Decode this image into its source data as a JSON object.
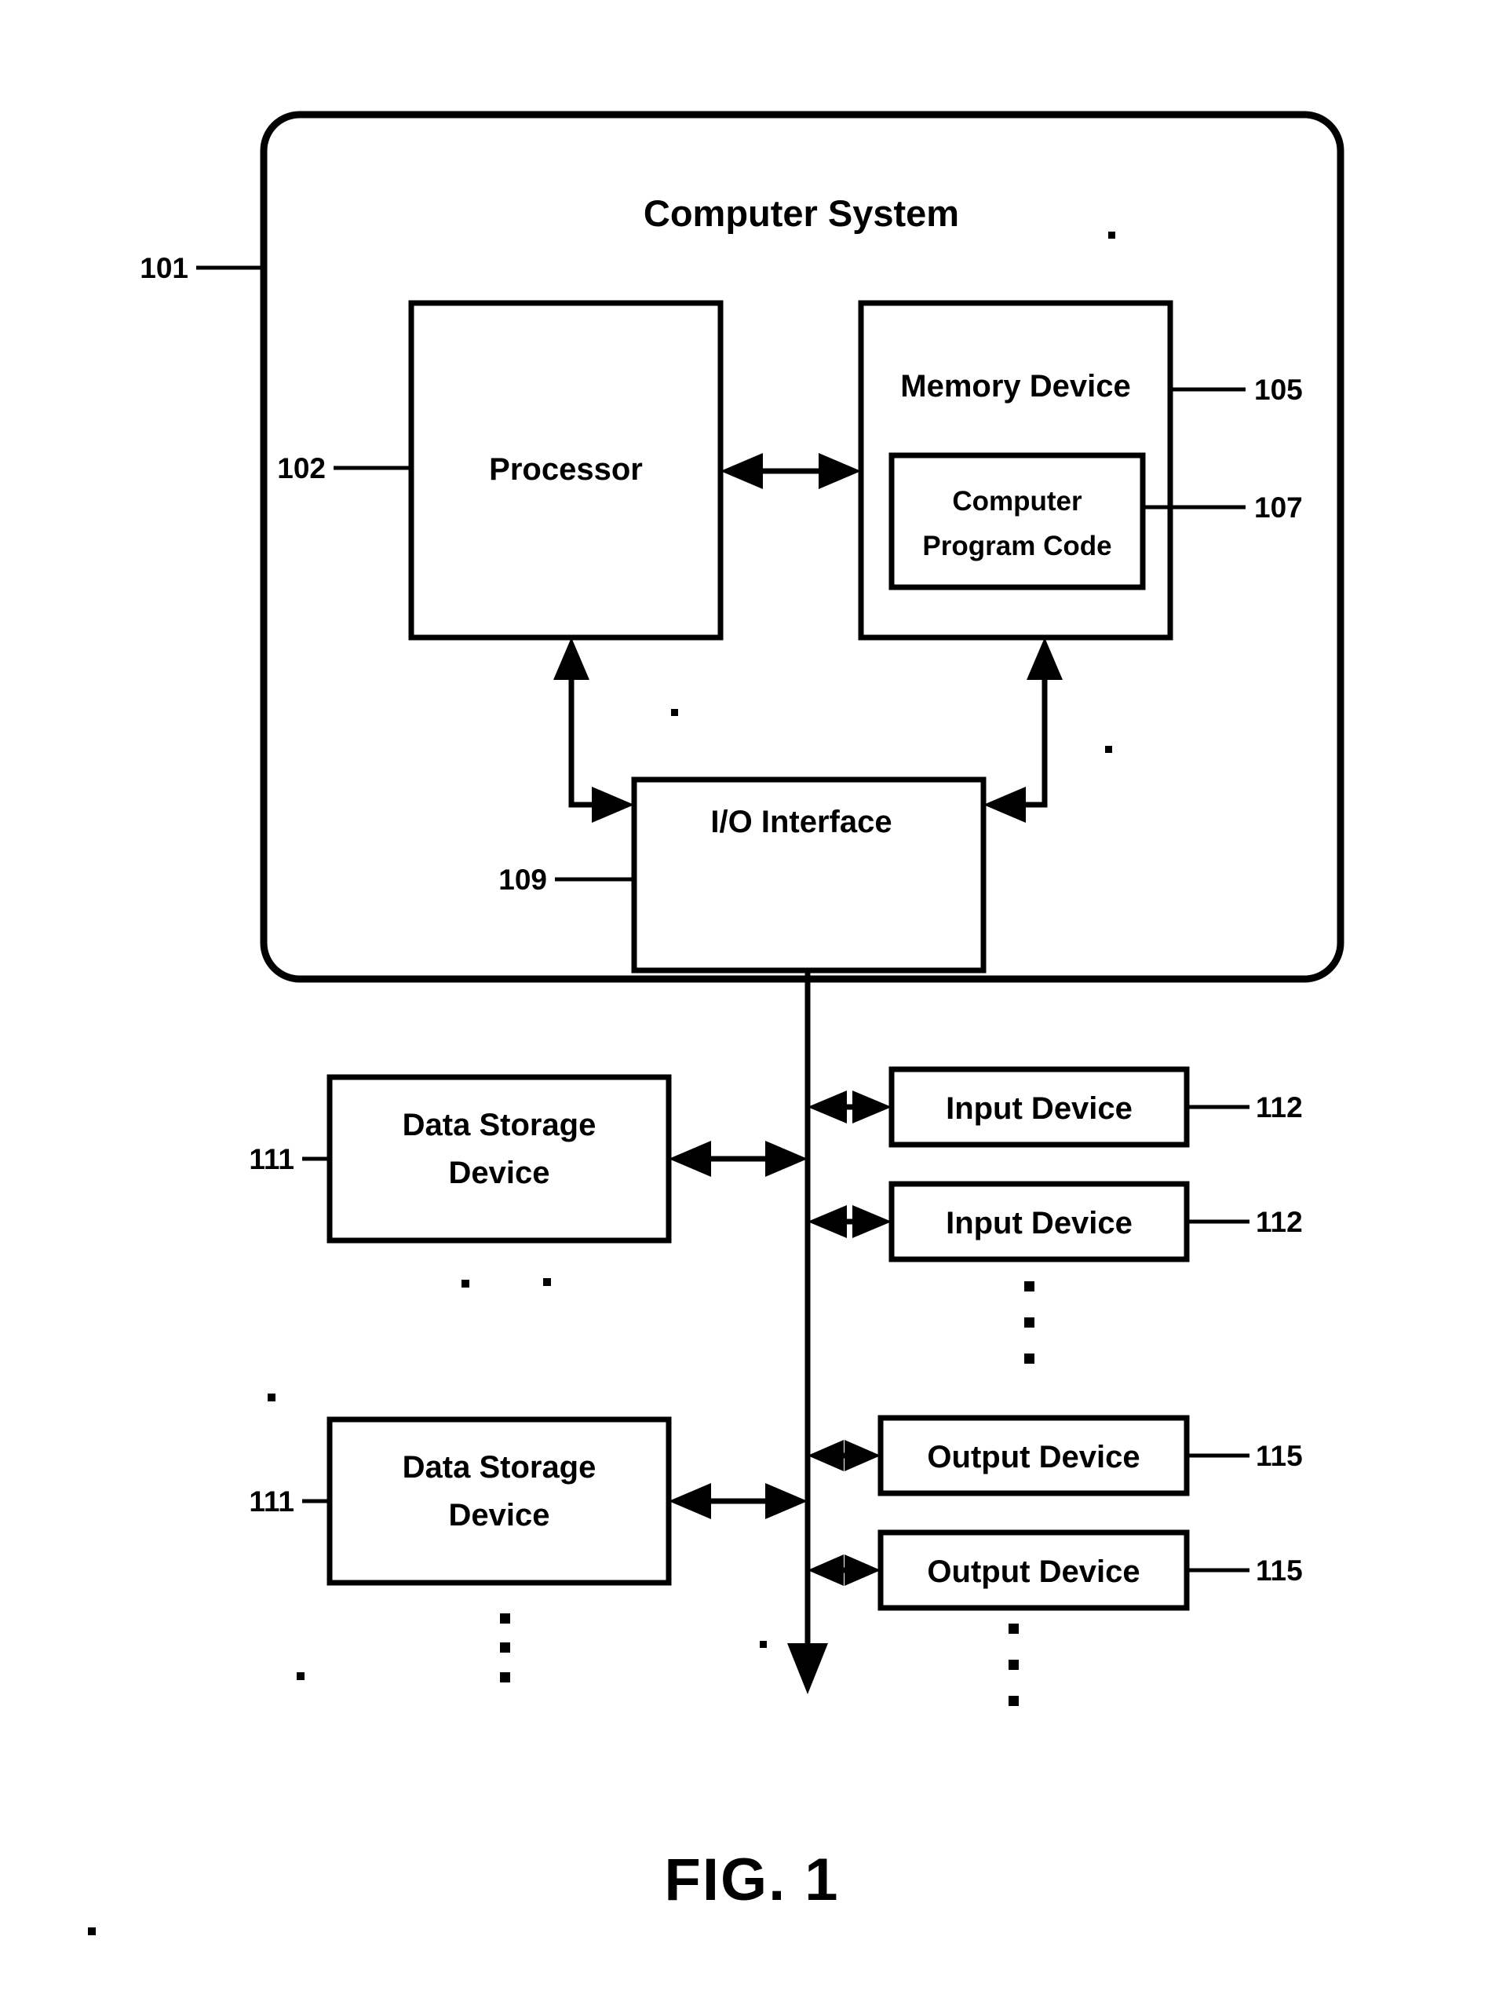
{
  "figure": {
    "caption": "FIG. 1",
    "title": "Computer System"
  },
  "blocks": {
    "computer_system": {
      "label": "Computer System",
      "ref": "101"
    },
    "processor": {
      "label": "Processor",
      "ref": "102"
    },
    "memory_device": {
      "label": "Memory Device",
      "ref": "105"
    },
    "computer_program_code": {
      "line1": "Computer",
      "line2": "Program Code",
      "ref": "107"
    },
    "io_interface": {
      "label": "I/O Interface",
      "ref": "109"
    },
    "data_storage_1": {
      "line1": "Data Storage",
      "line2": "Device",
      "ref": "111"
    },
    "data_storage_2": {
      "line1": "Data Storage",
      "line2": "Device",
      "ref": "111"
    },
    "input_device_1": {
      "label": "Input Device",
      "ref": "112"
    },
    "input_device_2": {
      "label": "Input Device",
      "ref": "112"
    },
    "output_device_1": {
      "label": "Output Device",
      "ref": "115"
    },
    "output_device_2": {
      "label": "Output Device",
      "ref": "115"
    }
  },
  "colors": {
    "ink": "#000000",
    "paper": "#ffffff"
  }
}
